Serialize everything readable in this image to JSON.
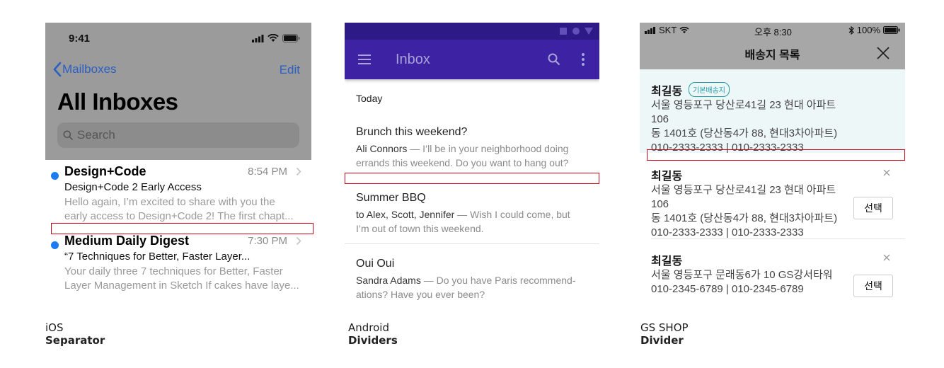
{
  "ios": {
    "time": "9:41",
    "back_label": "Mailboxes",
    "edit_label": "Edit",
    "title": "All Inboxes",
    "search_placeholder": "Search",
    "mails": [
      {
        "sender": "Design+Code",
        "time": "8:54 PM",
        "subject": "Design+Code 2 Early Access",
        "preview_line1": "Hello again, I’m excited to share with you the",
        "preview_line2": "early access to Design+Code 2! The first chapt..."
      },
      {
        "sender": "Medium Daily Digest",
        "time": "7:30 PM",
        "subject": "“7 Techniques for Better, Faster Layer...",
        "preview_line1": "Your daily three 7 techniques for Better, Faster",
        "preview_line2": "Layer Management in Sketch If cakes have laye..."
      }
    ],
    "caption_line1": "iOS",
    "caption_line2": "Separator"
  },
  "android": {
    "title": "Inbox",
    "section": "Today",
    "items": [
      {
        "title": "Brunch this weekend?",
        "who": "Ali Connors",
        "text_line1": " — I’ll be in your neighborhood doing",
        "text_line2": "errands this weekend. Do you want to hang out?"
      },
      {
        "title": "Summer BBQ",
        "who": "to Alex, Scott, Jennifer",
        "text_line1": " — Wish I could come, but",
        "text_line2": "I’m out of town this weekend."
      },
      {
        "title": "Oui Oui",
        "who": "Sandra Adams",
        "text_line1": " — Do you have Paris recommend-",
        "text_line2": "ations? Have you ever been?"
      }
    ],
    "caption_line1": "Android",
    "caption_line2": "Dividers"
  },
  "gs": {
    "carrier": "SKT",
    "time": "오후 8:30",
    "battery": "100%",
    "title": "배송지 목록",
    "addresses": [
      {
        "name": "최길동",
        "badge": "기본배송지",
        "line1": "서울 영등포구 당산로41길 23 현대 아파트 106",
        "line2": "동 1401호 (당산동4가 88, 현대3차아파트)",
        "phone": "010-2333-2333  |  010-2333-2333"
      },
      {
        "name": "최길동",
        "line1": "서울 영등포구 당산로41길 23 현대 아파트 106",
        "line2": "동 1401호 (당산동4가 88, 현대3차아파트)",
        "phone": "010-2333-2333  |  010-2333-2333",
        "select_label": "선택"
      },
      {
        "name": "최길동",
        "line1": "서울 영등포구 문래동6가 10 GS강서타워",
        "phone": "010-2345-6789  |  010-2345-6789",
        "select_label": "선택"
      }
    ],
    "caption_line1": "GS SHOP",
    "caption_line2": "Divider"
  }
}
